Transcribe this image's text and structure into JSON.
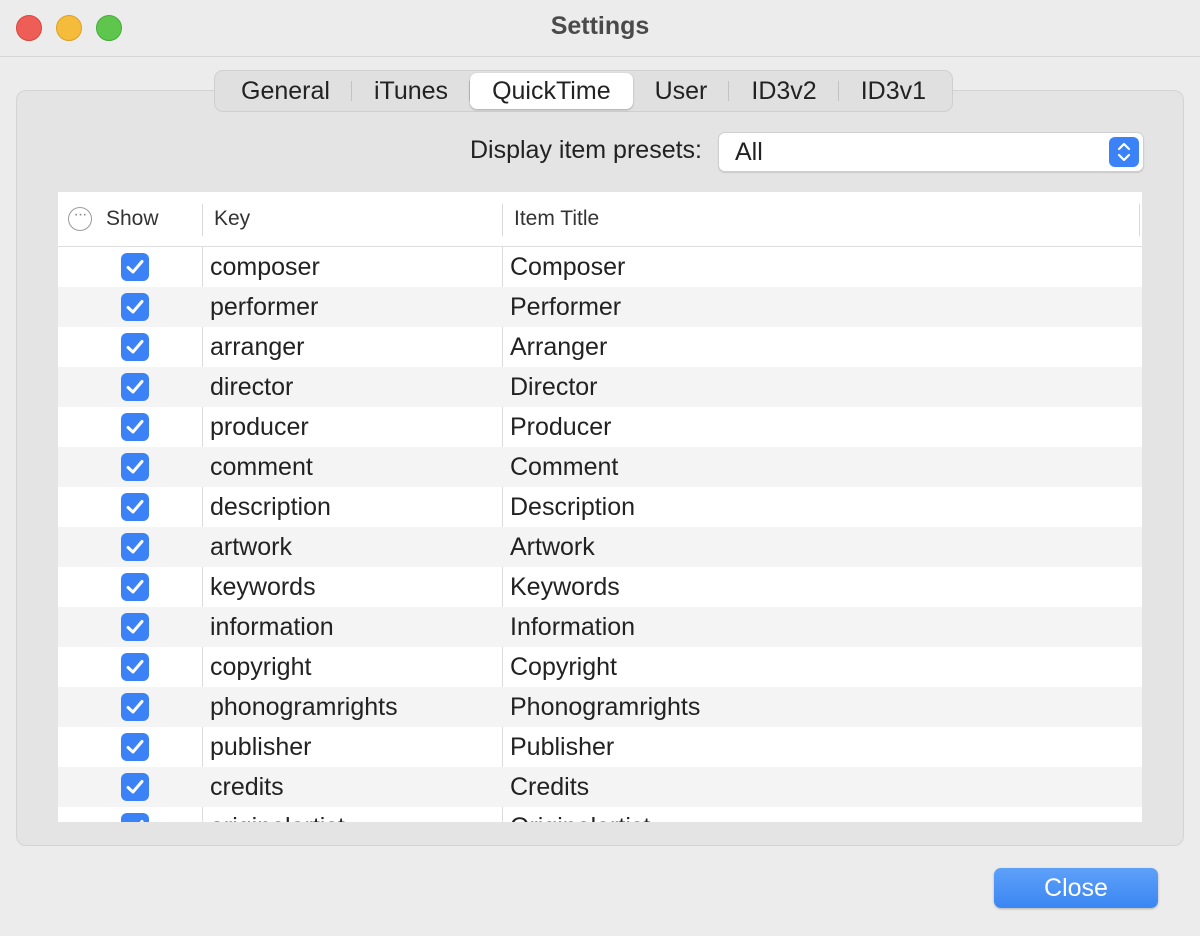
{
  "window": {
    "title": "Settings"
  },
  "tabs": [
    {
      "label": "General",
      "active": false
    },
    {
      "label": "iTunes",
      "active": false
    },
    {
      "label": "QuickTime",
      "active": true
    },
    {
      "label": "User",
      "active": false
    },
    {
      "label": "ID3v2",
      "active": false
    },
    {
      "label": "ID3v1",
      "active": false
    }
  ],
  "presets": {
    "label": "Display item presets:",
    "value": "All"
  },
  "table": {
    "headers": {
      "show": "Show",
      "key": "Key",
      "item_title": "Item Title"
    },
    "rows": [
      {
        "checked": true,
        "key": "composer",
        "title": "Composer"
      },
      {
        "checked": true,
        "key": "performer",
        "title": "Performer"
      },
      {
        "checked": true,
        "key": "arranger",
        "title": "Arranger"
      },
      {
        "checked": true,
        "key": "director",
        "title": "Director"
      },
      {
        "checked": true,
        "key": "producer",
        "title": "Producer"
      },
      {
        "checked": true,
        "key": "comment",
        "title": "Comment"
      },
      {
        "checked": true,
        "key": "description",
        "title": "Description"
      },
      {
        "checked": true,
        "key": "artwork",
        "title": "Artwork"
      },
      {
        "checked": true,
        "key": "keywords",
        "title": "Keywords"
      },
      {
        "checked": true,
        "key": "information",
        "title": "Information"
      },
      {
        "checked": true,
        "key": "copyright",
        "title": "Copyright"
      },
      {
        "checked": true,
        "key": "phonogramrights",
        "title": "Phonogramrights"
      },
      {
        "checked": true,
        "key": "publisher",
        "title": "Publisher"
      },
      {
        "checked": true,
        "key": "credits",
        "title": "Credits"
      },
      {
        "checked": true,
        "key": "originalartist",
        "title": "Originalartist"
      }
    ]
  },
  "buttons": {
    "close": "Close"
  },
  "colors": {
    "accent": "#3b82f6",
    "close_red": "#ee5e57",
    "minimize_yellow": "#f4bc3a",
    "zoom_green": "#5fc64d"
  },
  "icons": {
    "more": "more-options-icon",
    "stepper": "up-down-chevron-icon",
    "check": "checkmark-icon"
  }
}
